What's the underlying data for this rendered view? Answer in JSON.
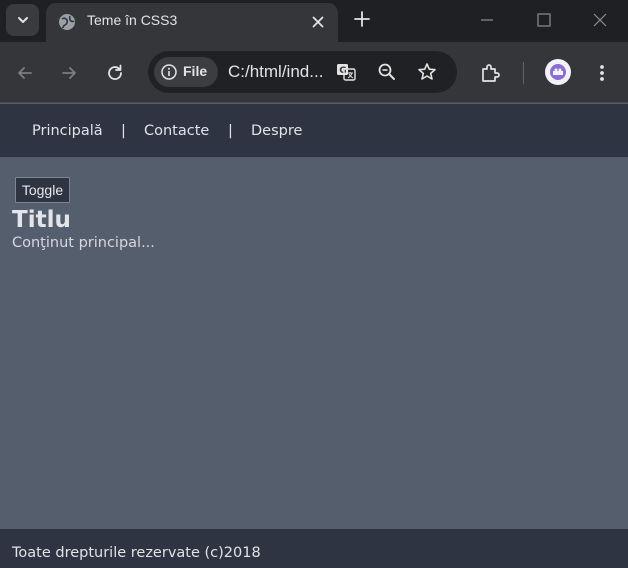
{
  "browser": {
    "tab": {
      "title": "Teme în CSS3",
      "favicon": "globe-icon",
      "close_icon": "close-icon"
    },
    "new_tab_icon": "plus-icon",
    "window_controls": [
      "minimize-icon",
      "maximize-icon",
      "close-icon"
    ],
    "toolbar": {
      "back_icon": "arrow-left-icon",
      "forward_icon": "arrow-right-icon",
      "reload_icon": "reload-icon",
      "site_info_label": "File",
      "url": "C:/html/ind...",
      "translate_icon": "translate-icon",
      "zoom_icon": "zoom-icon",
      "bookmark_icon": "star-icon",
      "extensions_icon": "puzzle-icon",
      "menu_icon": "kebab-menu-icon"
    }
  },
  "page": {
    "nav": {
      "items": [
        "Principală",
        "Contacte",
        "Despre"
      ],
      "separator": "|"
    },
    "main": {
      "toggle_label": "Toggle",
      "title": "Titlu",
      "content": "Conţinut principal..."
    },
    "footer": {
      "text": "Toate drepturile rezervate (c)2018"
    }
  },
  "colors": {
    "chrome_dark": "#1f2023",
    "chrome_toolbar": "#35363a",
    "nav_footer_bg": "#2e3441",
    "main_bg": "#555e6d",
    "text_light": "#dfe3ea"
  }
}
